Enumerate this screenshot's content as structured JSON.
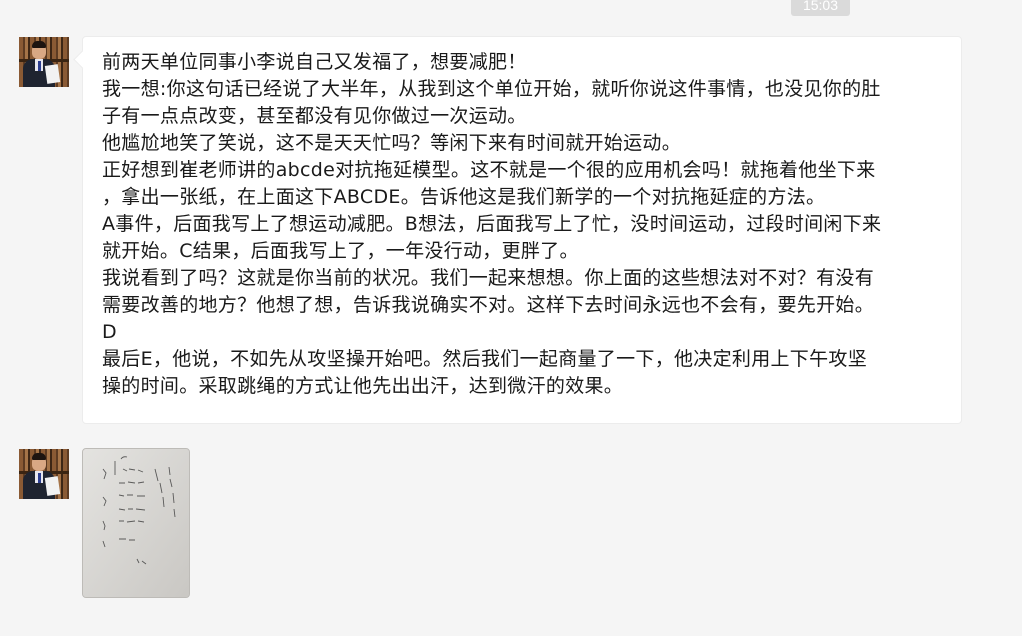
{
  "header": {
    "timestamp": "15:03"
  },
  "messages": [
    {
      "type": "text",
      "avatar_icon": "user-avatar-icon",
      "lines": [
        "前两天单位同事小李说自己又发福了，想要减肥！",
        "我一想:你这句话已经说了大半年，从我到这个单位开始，就听你说这件事情，也没见你的肚",
        "子有一点点改变，甚至都没有见你做过一次运动。",
        "他尴尬地笑了笑说，这不是天天忙吗？等闲下来有时间就开始运动。",
        "正好想到崔老师讲的abcde对抗拖延模型。这不就是一个很的应用机会吗！就拖着他坐下来",
        "，拿出一张纸，在上面这下ABCDE。告诉他这是我们新学的一个对抗拖延症的方法。",
        "A事件，后面我写上了想运动减肥。B想法，后面我写上了忙，没时间运动，过段时间闲下来",
        "就开始。C结果，后面我写上了，一年没行动，更胖了。",
        "我说看到了吗？这就是你当前的状况。我们一起来想想。你上面的这些想法对不对？有没有",
        "需要改善的地方？他想了想，告诉我说确实不对。这样下去时间永远也不会有，要先开始。",
        "D",
        "最后E，他说，不如先从攻坚操开始吧。然后我们一起商量了一下，他决定利用上下午攻坚",
        "操的时间。采取跳绳的方式让他先出出汗，达到微汗的效果。"
      ]
    },
    {
      "type": "image",
      "avatar_icon": "user-avatar-icon",
      "image_icon": "handwritten-note-photo"
    }
  ],
  "colors": {
    "background": "#f5f5f5",
    "bubble": "#ffffff",
    "timestamp_bg": "#dadada",
    "text": "#1a1a1a"
  }
}
